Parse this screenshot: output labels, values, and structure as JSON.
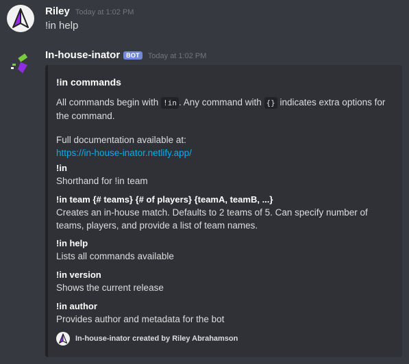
{
  "messages": [
    {
      "username": "Riley",
      "timestamp": "Today at 1:02 PM",
      "content": "!in help",
      "avatar_icon": "riley-avatar-logo"
    },
    {
      "username": "In-house-inator",
      "badge": "BOT",
      "timestamp": "Today at 1:02 PM",
      "avatar_icon": "bot-avatar-logo"
    }
  ],
  "embed": {
    "title": "!in commands",
    "desc_part1": "All commands begin with ",
    "desc_code1": "!in",
    "desc_part2": ". Any command with ",
    "desc_code2": "{}",
    "desc_part3": " indicates extra options for the command.",
    "doc_label": "Full documentation available at:",
    "doc_link": "https://in-house-inator.netlify.app/",
    "fields": [
      {
        "name": "!in",
        "value": "Shorthand for !in team"
      },
      {
        "name": "!in team {# teams} {# of players} {teamA, teamB, ...}",
        "value": "Creates an in-house match. Defaults to 2 teams of 5. Can specify number of teams, players, and provide a list of team names."
      },
      {
        "name": "!in help",
        "value": "Lists all commands available"
      },
      {
        "name": "!in version",
        "value": "Shows the current release"
      },
      {
        "name": "!in author",
        "value": "Provides author and metadata for the bot"
      }
    ],
    "footer": "In-house-inator created by Riley Abrahamson"
  },
  "colors": {
    "background": "#36393f",
    "embed_background": "#2f3136",
    "link": "#00aff4",
    "bot_badge": "#7289da",
    "timestamp": "#72767d"
  }
}
